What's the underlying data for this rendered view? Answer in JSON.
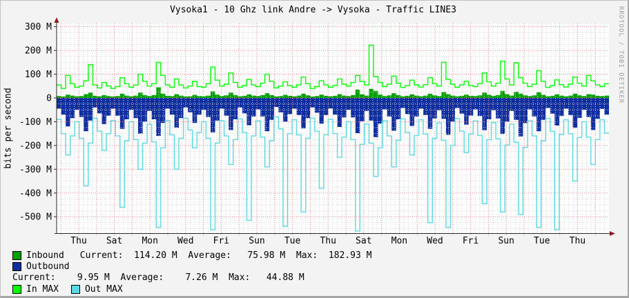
{
  "title": "Vysoka1 - 10 Ghz link Andre -> Vysoka - Traffic LINE3",
  "ylabel": "bits per second",
  "watermark": "RRDTOOL / TOBI OETIKER",
  "legend": {
    "inbound_label": "Inbound",
    "inbound_stats": "Current:  114.20 M  Average:   75.98 M  Max:  182.93 M",
    "outbound_label": "Outbound",
    "outbound_stats": "Current:    9.95 M  Average:    7.26 M  Max:   44.88 M",
    "in_max_label": "In MAX",
    "out_max_label": "Out MAX"
  },
  "colors": {
    "inbound": "#00a000",
    "outbound": "#0f2fa0",
    "in_max": "#00ff00",
    "out_max": "#5cd8e2",
    "grid_major": "#ef8a8a",
    "grid_minor": "#d6d6d6",
    "axis": "#2a2a2a",
    "arrow": "#8d1f1f",
    "background": "#f3f3f3",
    "plot_background": "#ffffff"
  },
  "chart_data": {
    "type": "area",
    "title": "Vysoka1 - 10 Ghz link Andre -> Vysoka - Traffic LINE3",
    "xlabel": "",
    "ylabel": "bits per second",
    "unit": "Mbit/s",
    "points_per_day": 4,
    "days_spanned": 30.5,
    "grid": true,
    "legend_position": "bottom",
    "ylim": [
      -573,
      314
    ],
    "y_ticks": [
      {
        "label": "300 M",
        "value": 300
      },
      {
        "label": "200 M",
        "value": 200
      },
      {
        "label": "100 M",
        "value": 100
      },
      {
        "label": "0",
        "value": 0
      },
      {
        "label": "-100 M",
        "value": -100
      },
      {
        "label": "-200 M",
        "value": -200
      },
      {
        "label": "-300 M",
        "value": -300
      },
      {
        "label": "-400 M",
        "value": -400
      },
      {
        "label": "-500 M",
        "value": -500
      }
    ],
    "x_tick_labels": [
      "Thu",
      "Sat",
      "Mon",
      "Wed",
      "Fri",
      "Sun",
      "Tue",
      "Thu",
      "Sat",
      "Mon",
      "Wed",
      "Fri",
      "Sun",
      "Tue",
      "Thu"
    ],
    "stats": {
      "inbound": {
        "current_M": 114.2,
        "average_M": 75.98,
        "max_M": 182.93
      },
      "outbound": {
        "current_M": 9.95,
        "average_M": 7.26,
        "max_M": 44.88
      }
    },
    "series": [
      {
        "name": "Inbound",
        "style": "area",
        "color": "#00a000",
        "values": [
          8,
          6,
          14,
          10,
          7,
          8,
          16,
          22,
          9,
          7,
          12,
          8,
          6,
          8,
          18,
          10,
          7,
          10,
          22,
          12,
          8,
          12,
          45,
          18,
          9,
          8,
          16,
          10,
          6,
          7,
          13,
          8,
          7,
          10,
          28,
          14,
          8,
          11,
          22,
          12,
          7,
          9,
          15,
          10,
          8,
          12,
          20,
          12,
          6,
          8,
          13,
          9,
          7,
          10,
          18,
          11,
          6,
          8,
          14,
          9,
          7,
          9,
          16,
          10,
          8,
          12,
          35,
          15,
          10,
          38,
          30,
          14,
          8,
          11,
          20,
          12,
          7,
          9,
          15,
          10,
          7,
          10,
          18,
          11,
          8,
          25,
          16,
          10,
          7,
          9,
          14,
          9,
          8,
          11,
          22,
          13,
          9,
          12,
          30,
          16,
          10,
          26,
          18,
          11,
          8,
          11,
          24,
          13,
          7,
          9,
          15,
          10,
          7,
          10,
          18,
          11,
          8,
          16,
          14,
          9,
          8,
          10
        ]
      },
      {
        "name": "Outbound",
        "style": "area",
        "color": "#0f2fa0",
        "values": [
          -45,
          -70,
          -120,
          -85,
          -50,
          -80,
          -140,
          -95,
          -40,
          -65,
          -110,
          -75,
          -45,
          -75,
          -130,
          -90,
          -50,
          -85,
          -150,
          -100,
          -55,
          -90,
          -160,
          -105,
          -45,
          -70,
          -125,
          -85,
          -40,
          -60,
          -105,
          -70,
          -50,
          -80,
          -145,
          -95,
          -45,
          -75,
          -135,
          -90,
          -40,
          -65,
          -115,
          -78,
          -48,
          -78,
          -140,
          -92,
          -38,
          -60,
          -100,
          -68,
          -45,
          -72,
          -128,
          -85,
          -40,
          -62,
          -108,
          -72,
          -44,
          -70,
          -122,
          -82,
          -50,
          -82,
          -148,
          -98,
          -55,
          -95,
          -165,
          -108,
          -48,
          -78,
          -138,
          -90,
          -42,
          -68,
          -118,
          -78,
          -45,
          -72,
          -130,
          -86,
          -52,
          -88,
          -155,
          -100,
          -42,
          -66,
          -112,
          -74,
          -48,
          -76,
          -136,
          -90,
          -52,
          -86,
          -152,
          -100,
          -55,
          -92,
          -162,
          -106,
          -48,
          -78,
          -140,
          -92,
          -42,
          -66,
          -116,
          -76,
          -45,
          -72,
          -126,
          -84,
          -50,
          -80,
          -135,
          -88,
          -46,
          -70
        ]
      },
      {
        "name": "In MAX",
        "style": "line",
        "color": "#00ff00",
        "values": [
          55,
          40,
          95,
          60,
          45,
          50,
          72,
          140,
          55,
          42,
          65,
          50,
          40,
          48,
          85,
          60,
          45,
          55,
          100,
          70,
          50,
          60,
          150,
          95,
          55,
          45,
          80,
          55,
          42,
          50,
          70,
          48,
          45,
          60,
          130,
          75,
          50,
          58,
          105,
          65,
          45,
          52,
          78,
          55,
          48,
          62,
          100,
          70,
          42,
          50,
          68,
          52,
          45,
          55,
          88,
          60,
          40,
          48,
          72,
          55,
          45,
          52,
          80,
          58,
          50,
          65,
          95,
          70,
          55,
          222,
          90,
          65,
          48,
          58,
          92,
          62,
          44,
          52,
          75,
          55,
          46,
          56,
          85,
          60,
          50,
          150,
          78,
          58,
          45,
          55,
          70,
          52,
          48,
          60,
          105,
          68,
          50,
          62,
          155,
          80,
          55,
          148,
          85,
          62,
          48,
          58,
          115,
          70,
          44,
          52,
          76,
          56,
          46,
          58,
          88,
          62,
          50,
          95,
          72,
          55,
          48,
          60
        ]
      },
      {
        "name": "Out MAX",
        "style": "line",
        "color": "#5cd8e2",
        "values": [
          -90,
          -150,
          -240,
          -160,
          -100,
          -170,
          -370,
          -190,
          -85,
          -140,
          -220,
          -150,
          -95,
          -160,
          -460,
          -180,
          -100,
          -175,
          -300,
          -190,
          -110,
          -185,
          -545,
          -210,
          -95,
          -155,
          -300,
          -170,
          -85,
          -135,
          -210,
          -145,
          -100,
          -170,
          -555,
          -190,
          -95,
          -160,
          -280,
          -175,
          -88,
          -145,
          -515,
          -160,
          -96,
          -165,
          -290,
          -180,
          -80,
          -130,
          -540,
          -150,
          -92,
          -155,
          -480,
          -170,
          -85,
          -140,
          -380,
          -155,
          -90,
          -150,
          -250,
          -165,
          -100,
          -175,
          -560,
          -195,
          -110,
          -190,
          -330,
          -210,
          -96,
          -160,
          -290,
          -178,
          -88,
          -145,
          -240,
          -158,
          -92,
          -152,
          -525,
          -170,
          -105,
          -178,
          -545,
          -200,
          -86,
          -140,
          -230,
          -152,
          -96,
          -158,
          -445,
          -176,
          -104,
          -172,
          -480,
          -198,
          -110,
          -186,
          -490,
          -208,
          -96,
          -160,
          -545,
          -180,
          -86,
          -140,
          -555,
          -154,
          -92,
          -150,
          -350,
          -166,
          -100,
          -165,
          -280,
          -175,
          -92,
          -148
        ]
      }
    ]
  }
}
